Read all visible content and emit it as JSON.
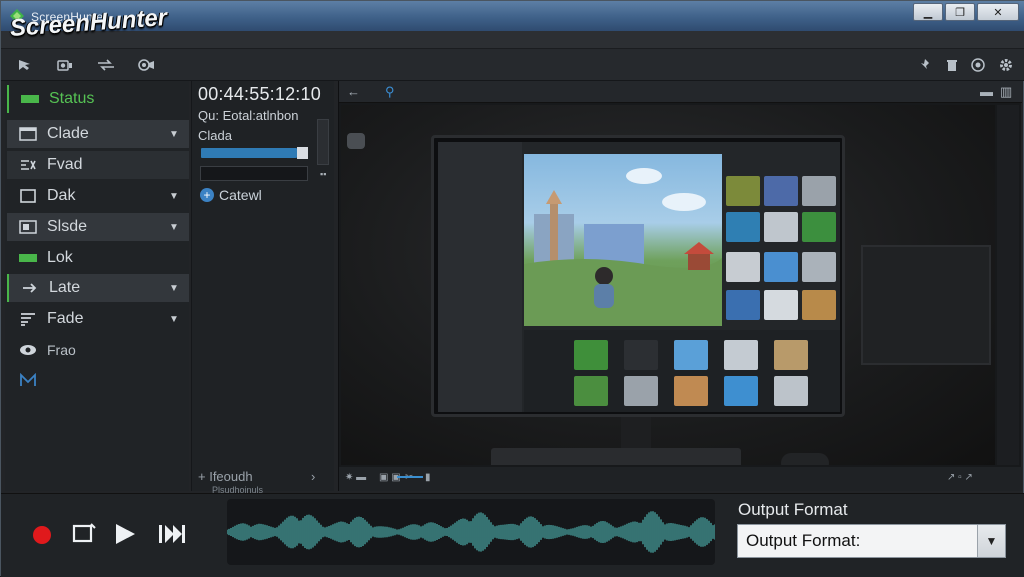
{
  "window": {
    "app_title": "ScreenHunter",
    "logo_text": "ScreenHunter",
    "controls": {
      "minimize": "▁",
      "maximize": "❐",
      "close": "✕"
    }
  },
  "toolbar": {
    "left_icons": [
      "cursor-icon",
      "camera-icon",
      "transfer-icon",
      "webcam-icon"
    ],
    "right_icons": [
      "pin-icon",
      "trash-icon",
      "settings-icon",
      "gear-icon"
    ]
  },
  "sidebar": {
    "items": [
      {
        "label": "Status",
        "icon": "status-icon",
        "has_chevron": false
      },
      {
        "label": "Clade",
        "icon": "window-icon",
        "has_chevron": true
      },
      {
        "label": "Fvad",
        "icon": "effects-icon",
        "has_chevron": false
      },
      {
        "label": "Dak",
        "icon": "frame-icon",
        "has_chevron": true
      },
      {
        "label": "Slsde",
        "icon": "slide-icon",
        "has_chevron": true
      },
      {
        "label": "Lok",
        "icon": "lock-icon",
        "has_chevron": false
      },
      {
        "label": "Late",
        "icon": "arrow-icon",
        "has_chevron": true
      },
      {
        "label": "Fade",
        "icon": "fade-icon",
        "has_chevron": true
      },
      {
        "label": "Frao",
        "icon": "eye-icon",
        "has_chevron": false
      },
      {
        "label": "",
        "icon": "m-icon",
        "has_chevron": false
      }
    ]
  },
  "midcol": {
    "timecode": "00:44:55:12:10",
    "line1": "Qu: Eotal:atlnbon",
    "line2": "Clada",
    "add_label": "Catewl",
    "bottom_label": "+ Ifeoudh",
    "bottom_small": "Plsudhoinuls",
    "bottom_arrow": "›"
  },
  "preview": {
    "back_icon": "←",
    "search_icon": "⚲"
  },
  "bottom": {
    "output_label": "Output Format",
    "output_value": "Output Format:",
    "dropdown_arrow": "▼"
  },
  "colors": {
    "accent_green": "#49b64a",
    "accent_blue": "#3a8fd0",
    "record_red": "#e0191c",
    "wave": "#3e8a88"
  }
}
